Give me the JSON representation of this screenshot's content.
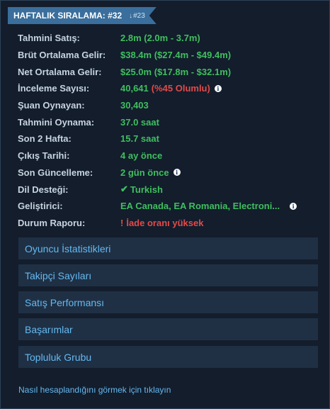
{
  "ranking": {
    "title": "HAFTALIK SIRALAMA: #32",
    "change_arrow": "↓",
    "change": "#23"
  },
  "stats": [
    {
      "label": "Tahmini Satış:",
      "value": "2.8m (2.0m - 3.7m)"
    },
    {
      "label": "Brüt Ortalama Gelir:",
      "value": "$38.4m ($27.4m - $49.4m)"
    },
    {
      "label": "Net Ortalama Gelir:",
      "value": "$25.0m ($17.8m - $32.1m)"
    },
    {
      "label": "İnceleme Sayısı:",
      "value": "40,641",
      "extra": "(%45 Olumlu)"
    },
    {
      "label": "Şuan Oynayan:",
      "value": "30,403"
    },
    {
      "label": "Tahmini Oynama:",
      "value": "37.0 saat"
    },
    {
      "label": "Son 2 Hafta:",
      "value": "15.7 saat"
    },
    {
      "label": "Çıkış Tarihi:",
      "value": "4 ay önce"
    },
    {
      "label": "Son Güncelleme:",
      "value": "2 gün önce"
    },
    {
      "label": "Dil Desteği:",
      "value": "Turkish",
      "icon": "check-icon"
    },
    {
      "label": "Geliştirici:",
      "value": "EA Canada, EA Romania, Electroni..."
    },
    {
      "label": "Durum Raporu:",
      "value": "İade oranı yüksek",
      "icon": "warning-icon"
    }
  ],
  "info_icon_glyph": "i",
  "check_glyph": "✔",
  "warn_glyph": "!",
  "buttons": [
    "Oyuncu İstatistikleri",
    "Takipçi Sayıları",
    "Satış Performansı",
    "Başarımlar",
    "Topluluk Grubu"
  ],
  "footer_link": "Nasıl hesaplandığını görmek için tıklayın",
  "colors": {
    "background": "#131d2c",
    "ribbon": "#3a6e9c",
    "positive": "#3fbf5f",
    "negative": "#e24a4a",
    "link": "#65b9f0",
    "button_bg": "#1f3045"
  }
}
